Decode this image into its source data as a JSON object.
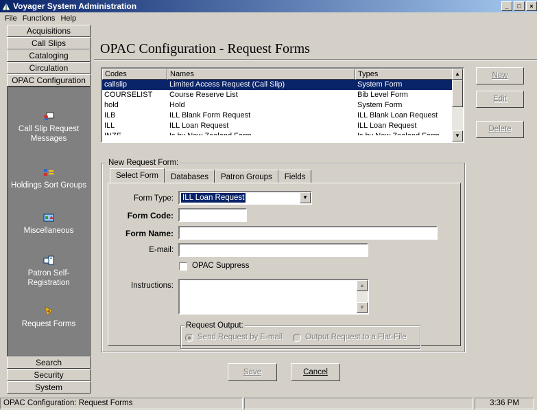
{
  "window": {
    "title": "Voyager System Administration"
  },
  "menu": [
    "File",
    "Functions",
    "Help"
  ],
  "sidebar": {
    "top_buttons": [
      "Acquisitions",
      "Call Slips",
      "Cataloging",
      "Circulation",
      "OPAC Configuration"
    ],
    "items": [
      {
        "label": "Call Slip Request Messages",
        "icon": "call-slip-icon"
      },
      {
        "label": "Holdings Sort Groups",
        "icon": "holdings-icon"
      },
      {
        "label": "Miscellaneous",
        "icon": "misc-icon"
      },
      {
        "label": "Patron Self-Registration",
        "icon": "patron-icon"
      },
      {
        "label": "Request Forms",
        "icon": "request-forms-icon"
      }
    ],
    "bottom_buttons": [
      "Search",
      "Security",
      "System"
    ]
  },
  "page": {
    "title": "OPAC Configuration - Request Forms"
  },
  "list": {
    "headers": [
      "Codes",
      "Names",
      "Types"
    ],
    "rows": [
      [
        "callslip",
        "Limited Access Request (Call Slip)",
        "System Form"
      ],
      [
        "COURSELIST",
        "Course Reserve List",
        "Bib Level Form"
      ],
      [
        "hold",
        "Hold",
        "System Form"
      ],
      [
        "ILB",
        "ILL Blank Form Request",
        "ILL Blank Loan Request"
      ],
      [
        "ILL",
        "ILL Loan Request",
        "ILL Loan Request"
      ],
      [
        "INZE",
        "Is by New Zealand Form",
        "Is by New Zealand Form"
      ]
    ],
    "selected_index": 0
  },
  "actions": {
    "new": "New",
    "edit": "Edit",
    "delete": "Delete"
  },
  "form": {
    "group_label": "New Request Form:",
    "tabs": [
      "Select Form",
      "Databases",
      "Patron Groups",
      "Fields"
    ],
    "active_tab": 0,
    "form_type_label": "Form Type:",
    "form_type_value": "ILL Loan Request",
    "form_code_label": "Form Code:",
    "form_code_value": "",
    "form_name_label": "Form Name:",
    "form_name_value": "",
    "email_label": "E-mail:",
    "email_value": "",
    "opac_suppress_label": "OPAC Suppress",
    "opac_suppress_checked": false,
    "instructions_label": "Instructions:",
    "instructions_value": "",
    "output_label": "Request Output:",
    "output_email": "Send Request by E-mail",
    "output_file": "Output Request to a Flat-File",
    "output_selected": "email"
  },
  "buttons": {
    "save": "Save",
    "cancel": "Cancel"
  },
  "status": {
    "text": "OPAC Configuration:  Request Forms",
    "time": "3:36 PM"
  }
}
